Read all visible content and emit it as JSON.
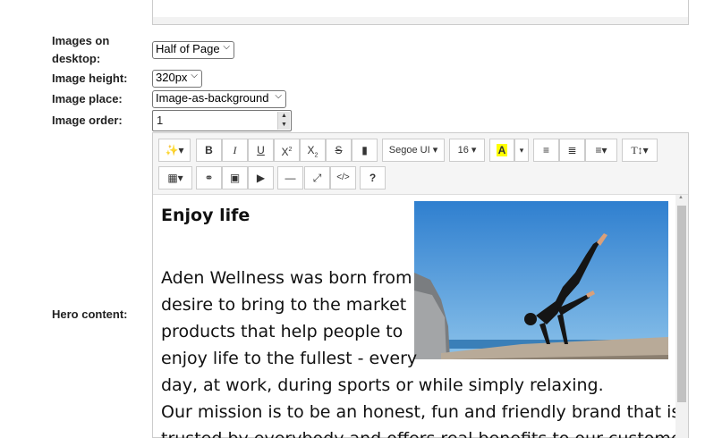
{
  "form": {
    "images_desktop_label": "Images on desktop:",
    "images_desktop_value": "Half of Page",
    "image_height_label": "Image height:",
    "image_height_value": "320px",
    "image_place_label": "Image place:",
    "image_place_value": "Image-as-background",
    "image_order_label": "Image order:",
    "image_order_value": "1",
    "hero_content_label": "Hero content:"
  },
  "toolbar": {
    "font_name": "Segoe UI",
    "font_size": "16",
    "bold": "B",
    "italic": "I",
    "underline": "U",
    "superscript": "X",
    "subscript": "X",
    "strikethrough": "S",
    "highlight": "A",
    "code_view": "</>",
    "help": "?"
  },
  "content": {
    "heading": "Enjoy life",
    "lines": [
      "Aden Wellness was born from",
      "desire to bring to the market",
      "products that help people to",
      "enjoy life to the fullest - every",
      "day, at work, during sports or while simply relaxing.",
      "Our mission is to be an honest, fun and friendly brand that is",
      "trusted by everybody and offers real benefits to our customers."
    ]
  },
  "colors": {
    "highlight": "#ffff00",
    "sky": "#3d8fd6"
  }
}
